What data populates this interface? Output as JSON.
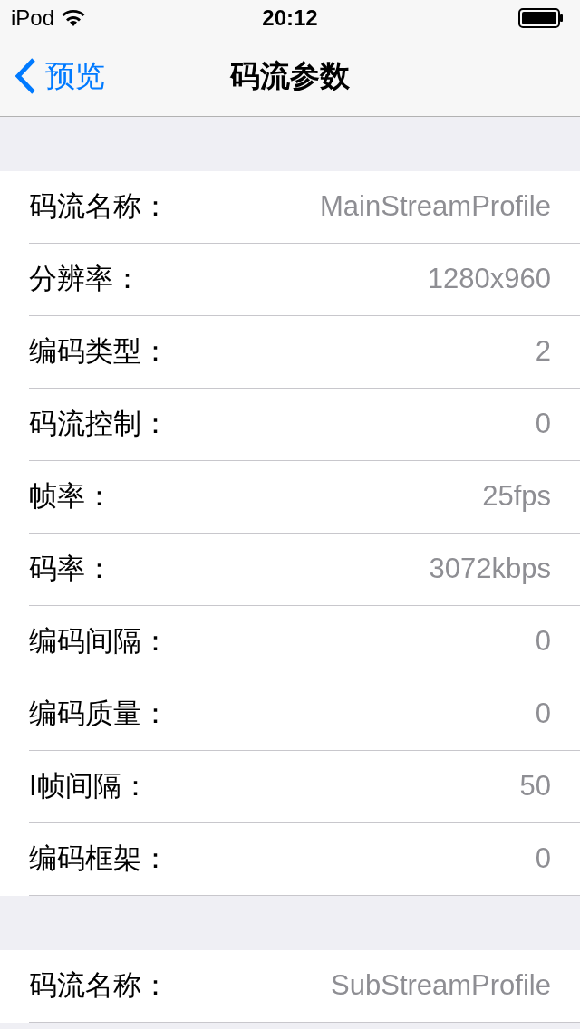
{
  "status_bar": {
    "carrier": "iPod",
    "time": "20:12"
  },
  "nav_bar": {
    "back": "预览",
    "title": "码流参数"
  },
  "sections": [
    {
      "rows": [
        {
          "label": "码流名称：",
          "value": "MainStreamProfile"
        },
        {
          "label": "分辨率：",
          "value": "1280x960"
        },
        {
          "label": "编码类型：",
          "value": "2"
        },
        {
          "label": "码流控制：",
          "value": "0"
        },
        {
          "label": "帧率：",
          "value": "25fps"
        },
        {
          "label": "码率：",
          "value": "3072kbps"
        },
        {
          "label": "编码间隔：",
          "value": "0"
        },
        {
          "label": "编码质量：",
          "value": "0"
        },
        {
          "label": "I帧间隔：",
          "value": "50"
        },
        {
          "label": "编码框架：",
          "value": "0"
        }
      ]
    },
    {
      "rows": [
        {
          "label": "码流名称：",
          "value": "SubStreamProfile"
        }
      ]
    }
  ]
}
